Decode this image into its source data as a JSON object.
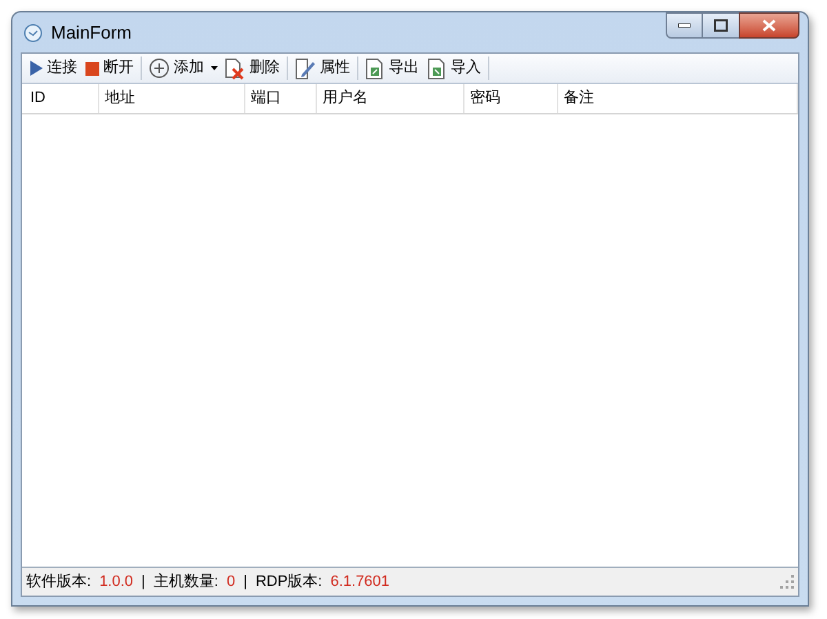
{
  "window": {
    "title": "MainForm"
  },
  "toolbar": [
    {
      "kind": "connect",
      "label": "连接"
    },
    {
      "kind": "disconnect",
      "label": "断开"
    },
    {
      "kind": "add",
      "label": "添加",
      "dropdown": true
    },
    {
      "kind": "delete",
      "label": "删除"
    },
    {
      "kind": "properties",
      "label": "属性"
    },
    {
      "kind": "export",
      "label": "导出"
    },
    {
      "kind": "import",
      "label": "导入"
    }
  ],
  "table": {
    "columns": [
      "ID",
      "地址",
      "端口",
      "用户名",
      "密码",
      "备注"
    ]
  },
  "status_bar": [
    {
      "label": "软件版本:",
      "value": "1.0.0"
    },
    {
      "label": "主机数量:",
      "value": "0"
    },
    {
      "label": "RDP版本:",
      "value": "6.1.7601"
    }
  ],
  "separator": "|"
}
